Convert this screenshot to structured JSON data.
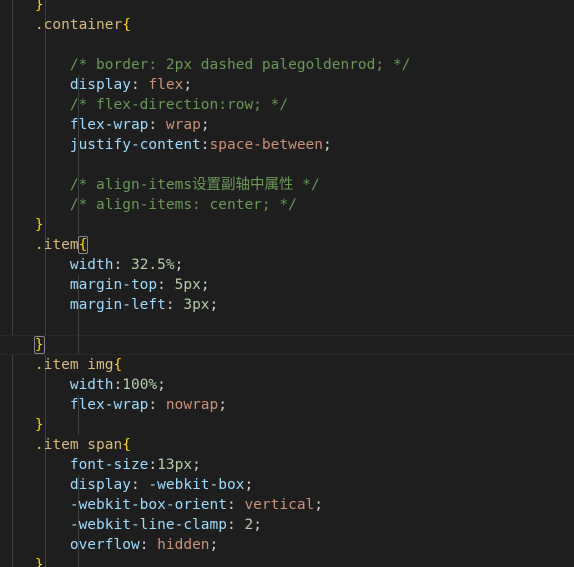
{
  "editor": {
    "language": "css",
    "theme": "dark-plus",
    "background_color": "#1e1e1e",
    "default_text_color": "#d4d4d4",
    "indent_guide_color": "#404040",
    "active_line_border_color": "#282828",
    "bracket_match_outline_color": "#888888",
    "colors": {
      "comment": "#6a9955",
      "property": "#9cdcfe",
      "string_value": "#ce9178",
      "number": "#b5cea8",
      "selector": "#d7ba7d",
      "punctuation": "#d4d4d4",
      "brace_level_1": "#ffd700",
      "brace_level_2": "#da70d6",
      "brace_level_3": "#179fff"
    }
  },
  "lines": [
    {
      "id": "line-01",
      "active": false,
      "tokens": [
        {
          "text": "    ",
          "cls": "c-plain"
        },
        {
          "text": "}",
          "cls": "c-brace"
        }
      ]
    },
    {
      "id": "line-02",
      "active": false,
      "tokens": [
        {
          "text": "    ",
          "cls": "c-plain"
        },
        {
          "text": ".container",
          "cls": "c-sel"
        },
        {
          "text": "{",
          "cls": "c-brace"
        }
      ]
    },
    {
      "id": "line-03",
      "active": false,
      "tokens": []
    },
    {
      "id": "line-04",
      "active": false,
      "tokens": [
        {
          "text": "        ",
          "cls": "c-plain"
        },
        {
          "text": "/* border: 2px dashed palegoldenrod; */",
          "cls": "c-comment"
        }
      ]
    },
    {
      "id": "line-05",
      "active": false,
      "tokens": [
        {
          "text": "        ",
          "cls": "c-plain"
        },
        {
          "text": "display",
          "cls": "c-prop"
        },
        {
          "text": ": ",
          "cls": "c-punct"
        },
        {
          "text": "flex",
          "cls": "c-value"
        },
        {
          "text": ";",
          "cls": "c-punct"
        }
      ]
    },
    {
      "id": "line-06",
      "active": false,
      "tokens": [
        {
          "text": "        ",
          "cls": "c-plain"
        },
        {
          "text": "/* flex-direction:row; */",
          "cls": "c-comment"
        }
      ]
    },
    {
      "id": "line-07",
      "active": false,
      "tokens": [
        {
          "text": "        ",
          "cls": "c-plain"
        },
        {
          "text": "flex-wrap",
          "cls": "c-prop"
        },
        {
          "text": ": ",
          "cls": "c-punct"
        },
        {
          "text": "wrap",
          "cls": "c-value"
        },
        {
          "text": ";",
          "cls": "c-punct"
        }
      ]
    },
    {
      "id": "line-08",
      "active": false,
      "tokens": [
        {
          "text": "        ",
          "cls": "c-plain"
        },
        {
          "text": "justify-content",
          "cls": "c-prop"
        },
        {
          "text": ":",
          "cls": "c-punct"
        },
        {
          "text": "space-between",
          "cls": "c-value"
        },
        {
          "text": ";",
          "cls": "c-punct"
        }
      ]
    },
    {
      "id": "line-09",
      "active": false,
      "tokens": []
    },
    {
      "id": "line-10",
      "active": false,
      "tokens": [
        {
          "text": "        ",
          "cls": "c-plain"
        },
        {
          "text": "/* align-items设置副轴中属性 */",
          "cls": "c-comment"
        }
      ]
    },
    {
      "id": "line-11",
      "active": false,
      "tokens": [
        {
          "text": "        ",
          "cls": "c-plain"
        },
        {
          "text": "/* align-items: center; */",
          "cls": "c-comment"
        }
      ]
    },
    {
      "id": "line-12",
      "active": false,
      "tokens": [
        {
          "text": "    ",
          "cls": "c-plain"
        },
        {
          "text": "}",
          "cls": "c-brace"
        }
      ]
    },
    {
      "id": "line-13",
      "active": false,
      "tokens": [
        {
          "text": "    ",
          "cls": "c-plain"
        },
        {
          "text": ".item",
          "cls": "c-sel"
        },
        {
          "text": "{",
          "cls": "c-brace",
          "bracket_match": true
        }
      ]
    },
    {
      "id": "line-14",
      "active": false,
      "tokens": [
        {
          "text": "        ",
          "cls": "c-plain"
        },
        {
          "text": "width",
          "cls": "c-prop"
        },
        {
          "text": ": ",
          "cls": "c-punct"
        },
        {
          "text": "32.5%",
          "cls": "c-number"
        },
        {
          "text": ";",
          "cls": "c-punct"
        }
      ]
    },
    {
      "id": "line-15",
      "active": false,
      "tokens": [
        {
          "text": "        ",
          "cls": "c-plain"
        },
        {
          "text": "margin-top",
          "cls": "c-prop"
        },
        {
          "text": ": ",
          "cls": "c-punct"
        },
        {
          "text": "5px",
          "cls": "c-number"
        },
        {
          "text": ";",
          "cls": "c-punct"
        }
      ]
    },
    {
      "id": "line-16",
      "active": false,
      "tokens": [
        {
          "text": "        ",
          "cls": "c-plain"
        },
        {
          "text": "margin-left",
          "cls": "c-prop"
        },
        {
          "text": ": ",
          "cls": "c-punct"
        },
        {
          "text": "3px",
          "cls": "c-number"
        },
        {
          "text": ";",
          "cls": "c-punct"
        }
      ]
    },
    {
      "id": "line-17",
      "active": false,
      "tokens": []
    },
    {
      "id": "line-18",
      "active": true,
      "tokens": [
        {
          "text": "    ",
          "cls": "c-plain"
        },
        {
          "text": "}",
          "cls": "c-brace",
          "bracket_match": true
        }
      ]
    },
    {
      "id": "line-19",
      "active": false,
      "tokens": [
        {
          "text": "    ",
          "cls": "c-plain"
        },
        {
          "text": ".item img",
          "cls": "c-sel"
        },
        {
          "text": "{",
          "cls": "c-brace"
        }
      ]
    },
    {
      "id": "line-20",
      "active": false,
      "tokens": [
        {
          "text": "        ",
          "cls": "c-plain"
        },
        {
          "text": "width",
          "cls": "c-prop"
        },
        {
          "text": ":",
          "cls": "c-punct"
        },
        {
          "text": "100%",
          "cls": "c-number"
        },
        {
          "text": ";",
          "cls": "c-punct"
        }
      ]
    },
    {
      "id": "line-21",
      "active": false,
      "tokens": [
        {
          "text": "        ",
          "cls": "c-plain"
        },
        {
          "text": "flex-wrap",
          "cls": "c-prop"
        },
        {
          "text": ": ",
          "cls": "c-punct"
        },
        {
          "text": "nowrap",
          "cls": "c-value"
        },
        {
          "text": ";",
          "cls": "c-punct"
        }
      ]
    },
    {
      "id": "line-22",
      "active": false,
      "tokens": [
        {
          "text": "    ",
          "cls": "c-plain"
        },
        {
          "text": "}",
          "cls": "c-brace"
        }
      ]
    },
    {
      "id": "line-23",
      "active": false,
      "tokens": [
        {
          "text": "    ",
          "cls": "c-plain"
        },
        {
          "text": ".item span",
          "cls": "c-sel"
        },
        {
          "text": "{",
          "cls": "c-brace"
        }
      ]
    },
    {
      "id": "line-24",
      "active": false,
      "tokens": [
        {
          "text": "        ",
          "cls": "c-plain"
        },
        {
          "text": "font-size",
          "cls": "c-prop"
        },
        {
          "text": ":",
          "cls": "c-punct"
        },
        {
          "text": "13px",
          "cls": "c-number"
        },
        {
          "text": ";",
          "cls": "c-punct"
        }
      ]
    },
    {
      "id": "line-25",
      "active": false,
      "tokens": [
        {
          "text": "        ",
          "cls": "c-plain"
        },
        {
          "text": "display",
          "cls": "c-prop"
        },
        {
          "text": ": ",
          "cls": "c-punct"
        },
        {
          "text": "-webkit-box",
          "cls": "c-prop"
        },
        {
          "text": ";",
          "cls": "c-punct"
        }
      ]
    },
    {
      "id": "line-26",
      "active": false,
      "tokens": [
        {
          "text": "        ",
          "cls": "c-plain"
        },
        {
          "text": "-webkit-box-orient",
          "cls": "c-prop"
        },
        {
          "text": ": ",
          "cls": "c-punct"
        },
        {
          "text": "vertical",
          "cls": "c-value"
        },
        {
          "text": ";",
          "cls": "c-punct"
        }
      ]
    },
    {
      "id": "line-27",
      "active": false,
      "tokens": [
        {
          "text": "        ",
          "cls": "c-plain"
        },
        {
          "text": "-webkit-line-clamp",
          "cls": "c-prop"
        },
        {
          "text": ": ",
          "cls": "c-punct"
        },
        {
          "text": "2",
          "cls": "c-number"
        },
        {
          "text": ";",
          "cls": "c-punct"
        }
      ]
    },
    {
      "id": "line-28",
      "active": false,
      "tokens": [
        {
          "text": "        ",
          "cls": "c-plain"
        },
        {
          "text": "overflow",
          "cls": "c-prop"
        },
        {
          "text": ": ",
          "cls": "c-punct"
        },
        {
          "text": "hidden",
          "cls": "c-value"
        },
        {
          "text": ";",
          "cls": "c-punct"
        }
      ]
    },
    {
      "id": "line-29",
      "active": false,
      "tokens": [
        {
          "text": "    ",
          "cls": "c-plain"
        },
        {
          "text": "}",
          "cls": "c-brace"
        }
      ]
    }
  ],
  "indent_guides_inner": [
    4,
    5,
    6,
    7,
    8,
    9,
    10,
    11,
    14,
    15,
    16,
    17,
    20,
    21,
    24,
    25,
    26,
    27,
    28
  ]
}
